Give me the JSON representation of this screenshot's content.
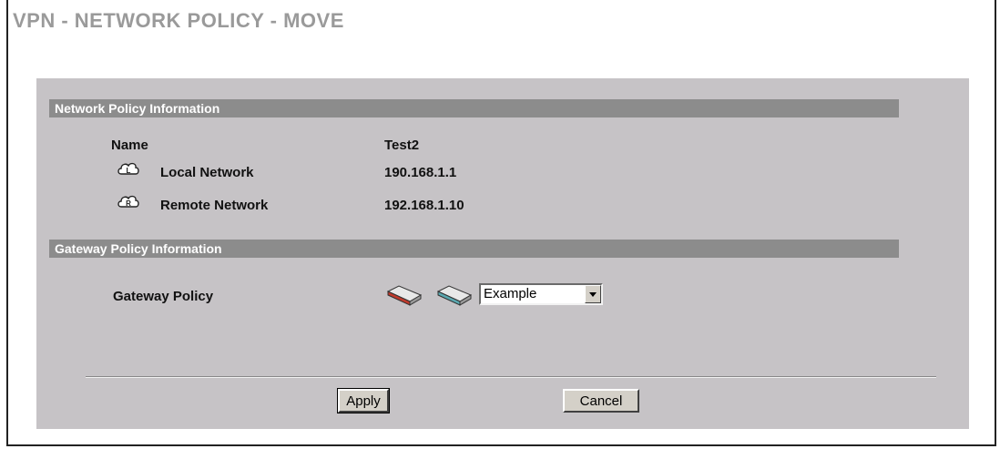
{
  "page": {
    "title": "VPN - NETWORK POLICY - MOVE"
  },
  "network_section": {
    "header": "Network Policy Information",
    "name_label": "Name",
    "name_value": "Test2",
    "local_label": "Local Network",
    "local_value": "190.168.1.1",
    "remote_label": "Remote Network",
    "remote_value": "192.168.1.10",
    "local_icon": "cloud-L-icon",
    "remote_icon": "cloud-R-icon"
  },
  "gateway_section": {
    "header": "Gateway Policy Information",
    "policy_label": "Gateway Policy",
    "policy_selected": "Example",
    "icons": [
      "router-red-icon",
      "router-teal-icon"
    ]
  },
  "buttons": {
    "apply": "Apply",
    "cancel": "Cancel"
  },
  "colors": {
    "section_bar": "#8c8c8c",
    "panel_bg": "#c6c3c6",
    "title": "#9a9a9a"
  }
}
